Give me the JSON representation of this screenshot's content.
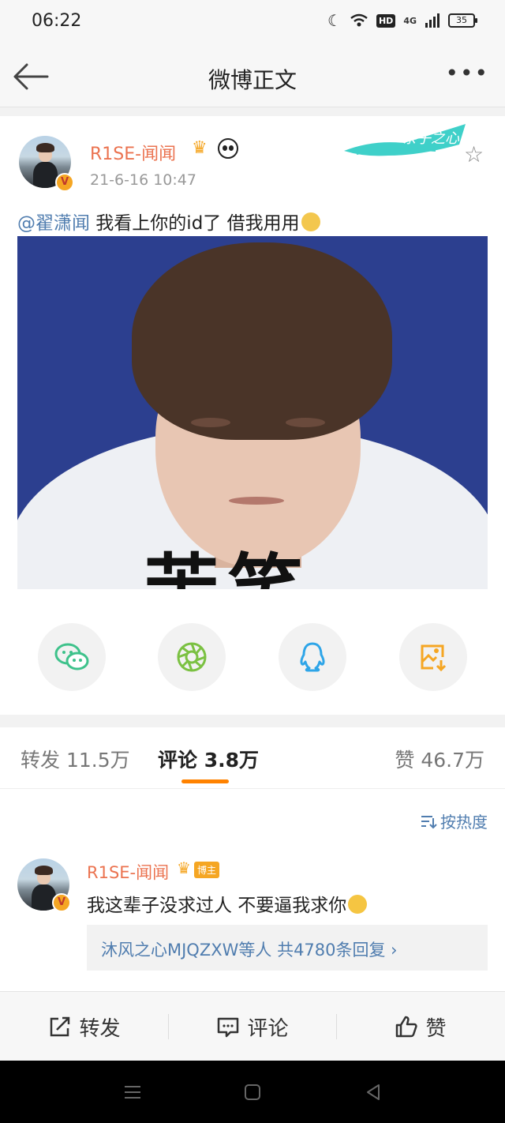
{
  "status_bar": {
    "time": "06:22",
    "network": "4G",
    "battery": "35"
  },
  "header": {
    "title": "微博正文"
  },
  "post": {
    "author": "R1SE-闻闻",
    "time": "21-6-16 10:47",
    "mention": "@翟潇闻",
    "text": " 我看上你的id了 借我用用",
    "image_caption": "苦笑",
    "brand_text": "亲子之心"
  },
  "tabs": {
    "repost": "转发 11.5万",
    "comments": "评论 3.8万",
    "likes": "赞 46.7万"
  },
  "comments": {
    "sort_label": "按热度",
    "items": [
      {
        "author": "R1SE-闻闻",
        "tag": "博主",
        "text": "我这辈子没求过人 不要逼我求你",
        "replies_users": "沐风之心MJQZXW等人",
        "replies_count": " 共4780条回复 ›"
      }
    ]
  },
  "actions": {
    "repost": "转发",
    "comment": "评论",
    "like": "赞"
  },
  "colors": {
    "username": "#eb7350",
    "link": "#507daf",
    "accent": "#ff8200",
    "wechat": "#3ec28b",
    "moments": "#7bc142",
    "qq": "#2ea5e8",
    "save": "#f5a623"
  }
}
